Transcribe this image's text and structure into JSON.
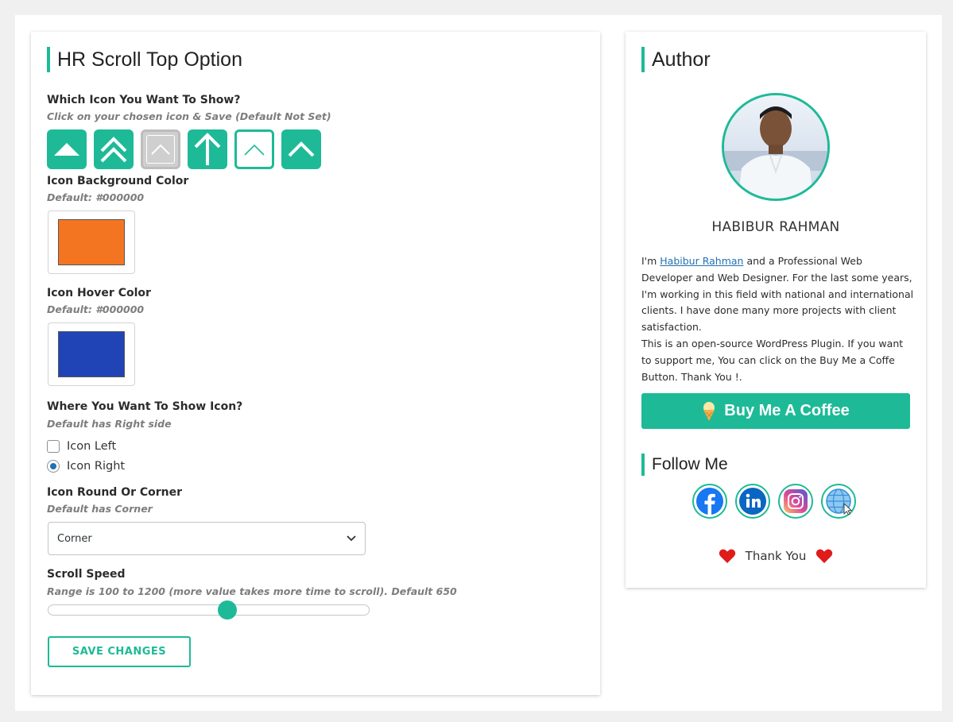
{
  "main": {
    "title": "HR Scroll Top Option",
    "icon_section": {
      "label": "Which Icon You Want To Show?",
      "hint": "Click on your chosen icon & Save (Default Not Set)"
    },
    "bg_color": {
      "label": "Icon Background Color",
      "hint": "Default: #000000",
      "value": "#f47521"
    },
    "hover_color": {
      "label": "Icon Hover Color",
      "hint": "Default: #000000",
      "value": "#2044b5"
    },
    "position": {
      "label": "Where You Want To Show Icon?",
      "hint": "Default has Right side",
      "options": [
        {
          "label": "Icon Left",
          "checked": false
        },
        {
          "label": "Icon Right",
          "checked": true
        }
      ]
    },
    "shape": {
      "label": "Icon Round Or Corner",
      "hint": "Default has Corner",
      "selected": "Corner"
    },
    "speed": {
      "label": "Scroll Speed",
      "hint": "Range is 100 to 1200 (more value takes more time to scroll). Default 650",
      "value_fraction": 0.557
    },
    "save_label": "SAVE CHANGES"
  },
  "author": {
    "title": "Author",
    "name": "HABIBUR RAHMAN",
    "bio_prefix": "I'm ",
    "bio_link": "Habibur Rahman",
    "bio_rest": " and a Professional Web Developer and Web Designer. For the last some years, I'm working in this field with national and international clients. I have done many more projects with client satisfaction.",
    "bio_line2": "This is an open-source WordPress Plugin. If you want to support me, You can click on the Buy Me a Coffe Button. Thank You !.",
    "coffee_label": "Buy Me A Coffee",
    "follow_title": "Follow Me",
    "thanks": "Thank You"
  },
  "colors": {
    "accent": "#1eba97",
    "heart": "#e01b1b",
    "link": "#2271b1"
  }
}
